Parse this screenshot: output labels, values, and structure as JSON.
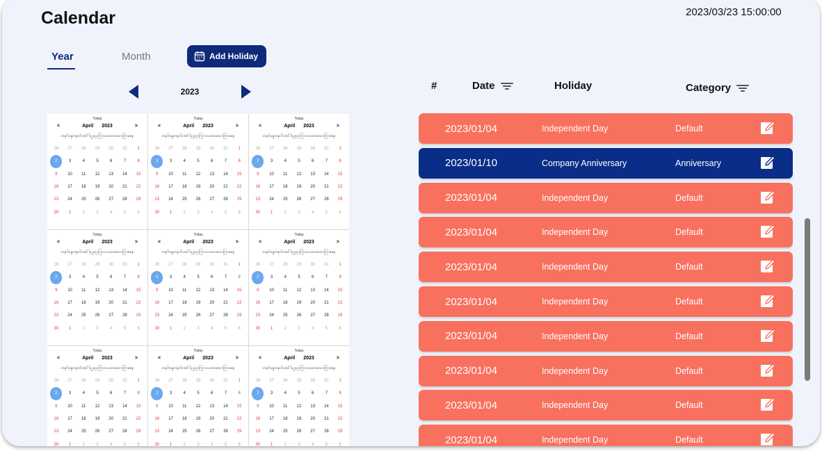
{
  "header": {
    "title": "Calendar",
    "datetime": "2023/03/23 15:00:00"
  },
  "tabs": [
    {
      "label": "Year",
      "active": true
    },
    {
      "label": "Month",
      "active": false
    }
  ],
  "add_button": {
    "label": "Add Holiday",
    "icon": "calendar-icon"
  },
  "year_nav": {
    "year": "2023"
  },
  "mini_calendar": {
    "today_label": "Today",
    "month_label": "April",
    "year_label": "2023",
    "prev": "<",
    "next": ">",
    "myanmar_text": "တနင်္ဂနွေတနင်္လာအင်္ဂါဗုဒ္ဓဟူးကြာသပတေးသောကြာစနေ",
    "days": [
      "26",
      "27",
      "28",
      "29",
      "30",
      "31",
      "1",
      "2",
      "3",
      "4",
      "5",
      "6",
      "7",
      "8",
      "9",
      "10",
      "11",
      "12",
      "13",
      "14",
      "15",
      "16",
      "17",
      "18",
      "19",
      "20",
      "21",
      "22",
      "23",
      "24",
      "25",
      "26",
      "27",
      "28",
      "29",
      "30",
      "1",
      "2",
      "3",
      "4",
      "5",
      "6"
    ],
    "selected_day_index": 7,
    "count": 9
  },
  "table": {
    "headers": {
      "num": "#",
      "date": "Date",
      "holiday": "Holiday",
      "category": "Category"
    },
    "rows": [
      {
        "date": "2023/01/04",
        "holiday": "Independent Day",
        "category": "Default",
        "highlight": false
      },
      {
        "date": "2023/01/10",
        "holiday": "Company Anniversary",
        "category": "Anniversary",
        "highlight": true
      },
      {
        "date": "2023/01/04",
        "holiday": "Independent Day",
        "category": "Default",
        "highlight": false
      },
      {
        "date": "2023/01/04",
        "holiday": "Independent Day",
        "category": "Default",
        "highlight": false
      },
      {
        "date": "2023/01/04",
        "holiday": "Independent Day",
        "category": "Default",
        "highlight": false
      },
      {
        "date": "2023/01/04",
        "holiday": "Independent Day",
        "category": "Default",
        "highlight": false
      },
      {
        "date": "2023/01/04",
        "holiday": "Independent Day",
        "category": "Default",
        "highlight": false
      },
      {
        "date": "2023/01/04",
        "holiday": "Independent Day",
        "category": "Default",
        "highlight": false
      },
      {
        "date": "2023/01/04",
        "holiday": "Independent Day",
        "category": "Default",
        "highlight": false
      },
      {
        "date": "2023/01/04",
        "holiday": "Independent Day",
        "category": "Default",
        "highlight": false
      }
    ]
  },
  "colors": {
    "primary": "#0e2a7a",
    "row": "#f8705e",
    "row_highlight": "#0a2d87",
    "selected_day": "#6aa8ef",
    "weekend_red": "#e23b3b"
  }
}
